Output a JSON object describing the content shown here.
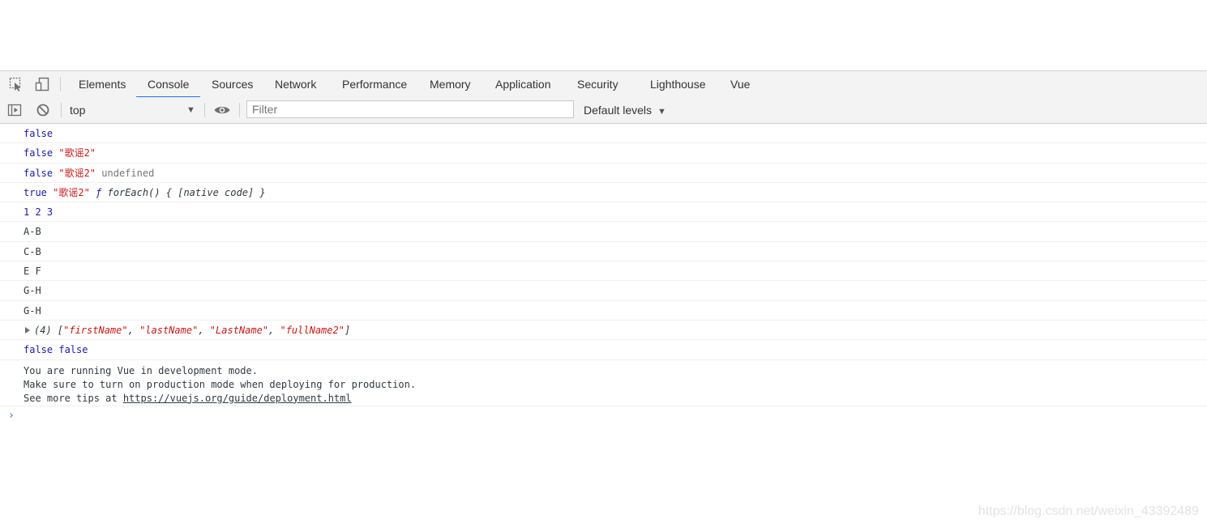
{
  "tabs": [
    {
      "label": "Elements"
    },
    {
      "label": "Console"
    },
    {
      "label": "Sources"
    },
    {
      "label": "Network"
    },
    {
      "label": "Performance"
    },
    {
      "label": "Memory"
    },
    {
      "label": "Application"
    },
    {
      "label": "Security"
    },
    {
      "label": "Lighthouse"
    },
    {
      "label": "Vue"
    }
  ],
  "active_tab": "Console",
  "toolbar": {
    "context": "top",
    "filter_placeholder": "Filter",
    "levels": "Default levels"
  },
  "console": {
    "m1": {
      "a": "false"
    },
    "m2": {
      "a": "false",
      "b": "\"歌谣2\""
    },
    "m3": {
      "a": "false",
      "b": "\"歌谣2\"",
      "c": "undefined"
    },
    "m4": {
      "a": "true",
      "b": "\"歌谣2\"",
      "c": "ƒ",
      "d": "forEach() { [native code] }"
    },
    "m5": {
      "a": "1 2 3"
    },
    "m6": {
      "a": "A-B"
    },
    "m7": {
      "a": "C-B"
    },
    "m8": {
      "a": "E F"
    },
    "m9": {
      "a": "G-H"
    },
    "m10": {
      "a": "G-H"
    },
    "m11": {
      "prefix": "(4) [",
      "items": [
        "\"firstName\"",
        "\"lastName\"",
        "\"LastName\"",
        "\"fullName2\""
      ],
      "sep": ", ",
      "suffix": "]"
    },
    "m12": {
      "a": "false false"
    },
    "m13": {
      "line1": "You are running Vue in development mode.",
      "line2": "Make sure to turn on production mode when deploying for production.",
      "line3_prefix": "See more tips at ",
      "line3_link": "https://vuejs.org/guide/deployment.html"
    },
    "prompt": "›"
  },
  "watermark": "https://blog.csdn.net/weixin_43392489",
  "colors": {
    "accent": "#1a73e8",
    "keyword": "#1a1aa6",
    "string": "#c41a16",
    "toolbar_bg": "#f3f3f3"
  }
}
